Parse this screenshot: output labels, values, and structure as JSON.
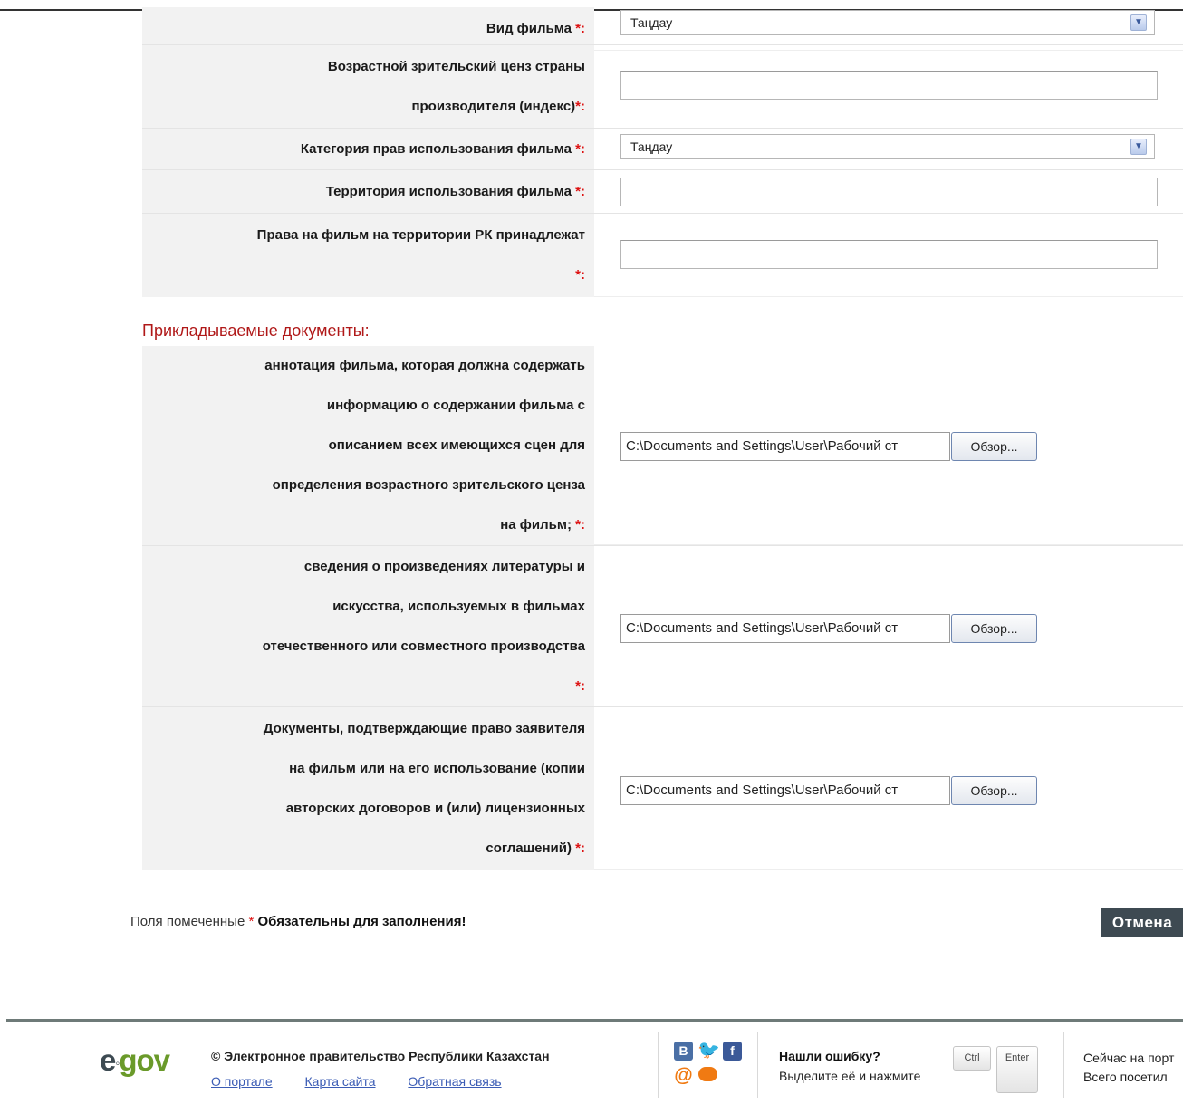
{
  "form": {
    "required_mark": "*:",
    "film_type": {
      "label": "Вид фильма",
      "value": "Таңдау"
    },
    "age_rating": {
      "label_line1": "Возрастной зрительский ценз страны",
      "label_line2": "производителя (индекс)"
    },
    "rights_category": {
      "label": "Категория прав использования фильма",
      "value": "Таңдау"
    },
    "territory": {
      "label": "Территория использования фильма"
    },
    "rights_holder": {
      "label_line1": "Права на фильм на территории РК принадлежат"
    }
  },
  "documents": {
    "title": "Прикладываемые документы:",
    "browse_label": "Обзор...",
    "items": [
      {
        "lines": [
          "аннотация фильма, которая должна содержать",
          "информацию о содержании фильма с",
          "описанием всех имеющихся сцен для",
          "определения возрастного зрительского ценза"
        ],
        "last": "на фильм;",
        "path": "C:\\Documents and Settings\\User\\Рабочий ст"
      },
      {
        "lines": [
          "сведения о произведениях литературы и",
          "искусства, используемых в фильмах",
          "отечественного или совместного производства"
        ],
        "last": "",
        "path": "C:\\Documents and Settings\\User\\Рабочий ст"
      },
      {
        "lines": [
          "Документы, подтверждающие право заявителя",
          "на фильм или на его использование (копии",
          "авторских договоров и (или) лицензионных"
        ],
        "last": "соглашений)",
        "path": "C:\\Documents and Settings\\User\\Рабочий ст"
      }
    ]
  },
  "note": {
    "prefix": "Поля помеченные",
    "star": "*",
    "bold": "Обязательны для заполнения!"
  },
  "cancel_label": "Отмена",
  "footer": {
    "logo_e": "e",
    "logo_gov": "gov",
    "copyright": "© Электронное правительство Республики Казахстан",
    "links": [
      "О портале",
      "Карта сайта",
      "Обратная связь"
    ],
    "error_title": "Нашли ошибку?",
    "error_text": "Выделите её и нажмите",
    "key_ctrl": "Ctrl",
    "key_enter": "Enter",
    "online_line1": "Сейчас на порт",
    "online_line2": "Всего посетил"
  },
  "colors": {
    "required": "#dd1111",
    "section_title": "#b01818",
    "link": "#3b5cb5",
    "cancel_bg": "#3e4a52"
  }
}
